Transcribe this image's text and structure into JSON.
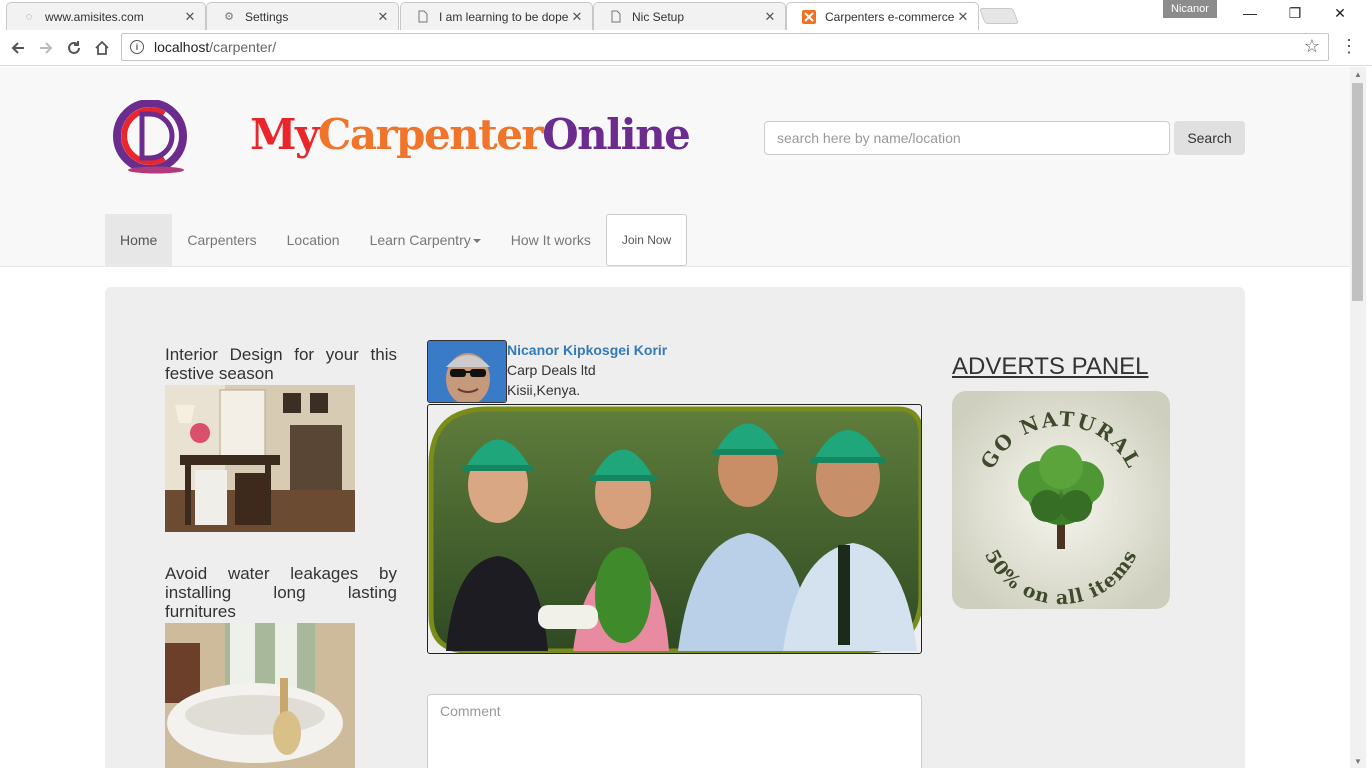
{
  "browser": {
    "tabs": [
      {
        "title": "www.amisites.com",
        "icon": "globe-icon",
        "active": false
      },
      {
        "title": "Settings",
        "icon": "gear-icon",
        "active": false
      },
      {
        "title": "I am learning to be dope",
        "icon": "page-icon",
        "active": false
      },
      {
        "title": "Nic Setup",
        "icon": "page-icon",
        "active": false
      },
      {
        "title": "Carpenters e-commerce",
        "icon": "xampp-icon",
        "active": true
      }
    ],
    "profile_name": "Nicanor",
    "url_host": "localhost",
    "url_path": "/carpenter/",
    "tab_close_glyph": "✕",
    "window_controls": {
      "minimize": "—",
      "restore": "❐",
      "close": "✕"
    }
  },
  "site": {
    "brand": {
      "part1": "My",
      "part2": "Carpenter",
      "part3": "Online"
    },
    "search": {
      "placeholder": "search here by name/location",
      "button": "Search"
    },
    "nav": {
      "home": "Home",
      "carpenters": "Carpenters",
      "location": "Location",
      "learn": "Learn Carpentry",
      "how": "How It works",
      "join": "Join Now"
    },
    "articles": [
      {
        "title": "Interior Design for your this festive season"
      },
      {
        "title": "Avoid water leakages by installing long lasting furnitures"
      }
    ],
    "profile": {
      "name": "Nicanor Kipkosgei Korir",
      "company": "Carp Deals ltd",
      "location": "Kisii,Kenya."
    },
    "comment_placeholder": "Comment",
    "adverts": {
      "title": "ADVERTS PANEL",
      "banner_top": "GO NATURAL",
      "banner_bottom": "50% on all items"
    }
  },
  "colors": {
    "brand_red": "#e8262b",
    "brand_orange": "#f0742a",
    "brand_purple": "#6b2c8e",
    "link_blue": "#337ab7"
  }
}
